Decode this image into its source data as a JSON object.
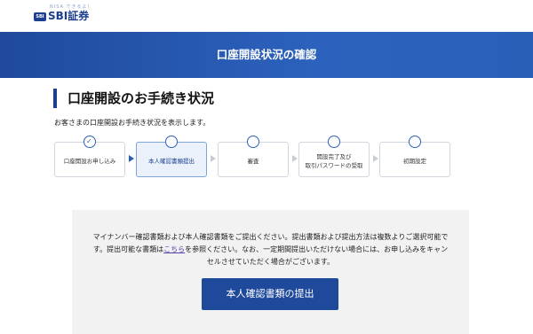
{
  "header": {
    "logo_tagline": "NISA できるよ!",
    "logo_mark": "SBI",
    "logo_text": "SBI証券"
  },
  "banner": {
    "title": "口座開設状況の確認"
  },
  "main": {
    "section_title": "口座開設のお手続き状況",
    "description": "お客さまの口座開設お手続き状況を表示します。"
  },
  "steps": [
    {
      "label": "口座開設お申し込み",
      "state": "done"
    },
    {
      "label": "本人確認書類提出",
      "state": "current"
    },
    {
      "label": "審査",
      "state": "pending"
    },
    {
      "label": "開設完了及び\n取引パスワードの受取",
      "state": "pending"
    },
    {
      "label": "初期設定",
      "state": "pending"
    }
  ],
  "notice": {
    "text_before_link": "マイナンバー確認書類および本人確認書類をご提出ください。提出書類および提出方法は複数よりご選択可能です。提出可能な書類は",
    "link_text": "こちら",
    "text_after_link": "を参照ください。なお、一定期間提出いただけない場合には、お申し込みをキャンセルさせていただく場合がございます。",
    "button_label": "本人確認書類の提出"
  },
  "colors": {
    "brand": "#1c3f8f",
    "banner": "#2a5fb8",
    "link": "#5a3fa8",
    "panel_bg": "#f2f2f2"
  }
}
